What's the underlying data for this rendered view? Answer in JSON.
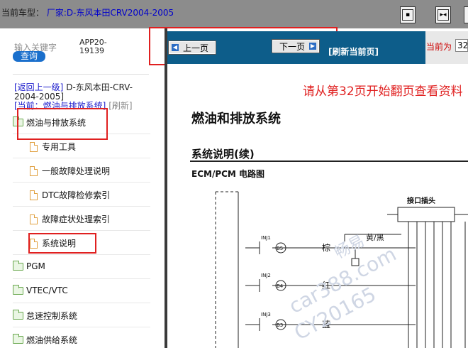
{
  "header": {
    "car_label": "当前车型：",
    "maker": "厂家:D-东风本田CRV2004-2005",
    "buttons": [
      {
        "icon": "window-toggle-icon",
        "label": "▪"
      },
      {
        "icon": "split-view-icon",
        "label": "▸◂"
      }
    ]
  },
  "sidebar": {
    "search_placeholder": "输入关键字",
    "search_button": "查询",
    "app_code": "APP20-19139",
    "back_link": "[返回上一级]",
    "back_target": "D-东风本田-CRV-2004-2005]",
    "current_prefix": "[当前：燃油与排放系统]",
    "refresh_link": "[刷新]",
    "tree": [
      {
        "type": "folder",
        "label": "燃油与排放系统",
        "level": 0
      },
      {
        "type": "doc",
        "label": "专用工具",
        "level": 1
      },
      {
        "type": "doc",
        "label": "一般故障处理说明",
        "level": 1
      },
      {
        "type": "doc",
        "label": "DTC故障检修索引",
        "level": 1
      },
      {
        "type": "doc",
        "label": "故障症状处理索引",
        "level": 1
      },
      {
        "type": "doc",
        "label": "系统说明",
        "level": 1
      },
      {
        "type": "folder",
        "label": "PGM",
        "level": 0
      },
      {
        "type": "folder",
        "label": "VTEC/VTC",
        "level": 0
      },
      {
        "type": "folder",
        "label": "怠速控制系统",
        "level": 0
      },
      {
        "type": "folder",
        "label": "燃油供给系统",
        "level": 0
      }
    ]
  },
  "pager": {
    "prev": "上一页",
    "next": "下一页",
    "refresh": "[刷新当前页]",
    "current_label": "当前为",
    "current_page": "32"
  },
  "document": {
    "hint": "请从第32页开始翻页查看资料",
    "title": "燃油和排放系统",
    "subtitle": "系统说明(续)",
    "diagram_title": "ECM/PCM 电路图",
    "connector_label": "接口插头",
    "pins": [
      {
        "id": "B5",
        "ref": "INJ1",
        "color": "棕"
      },
      {
        "id": "B4",
        "ref": "INJ2",
        "color": "红"
      },
      {
        "id": "B3",
        "ref": "INJ3",
        "color": "蓝"
      }
    ],
    "wire_label": "黄/黑",
    "watermark": [
      "畅易",
      "car388.com",
      "CY20165"
    ]
  }
}
